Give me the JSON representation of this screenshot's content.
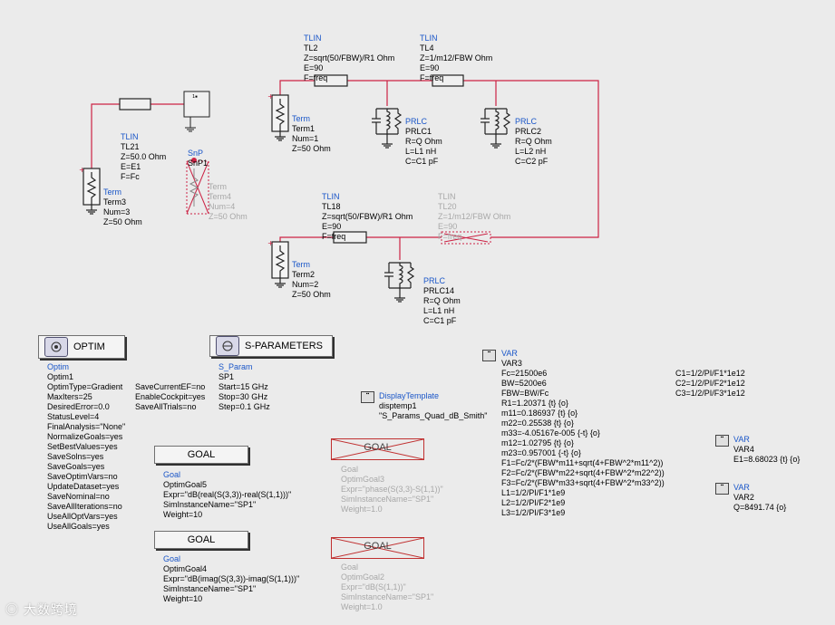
{
  "colors": {
    "wire": "#cc2244",
    "component": "#222222",
    "label_blue": "#1a56c8",
    "disabled": "#a8a8a8",
    "background": "#ebebeb"
  },
  "components": {
    "tl2": {
      "type": "TLIN",
      "name": "TL2",
      "z": "Z=sqrt(50/FBW)/R1 Ohm",
      "e": "E=90",
      "f": "F=freq"
    },
    "tl4": {
      "type": "TLIN",
      "name": "TL4",
      "z": "Z=1/m12/FBW Ohm",
      "e": "E=90",
      "f": "F=freq"
    },
    "tl21": {
      "type": "TLIN",
      "name": "TL21",
      "z": "Z=50.0 Ohm",
      "e": "E=E1",
      "f": "F=Fc"
    },
    "tl18": {
      "type": "TLIN",
      "name": "TL18",
      "z": "Z=sqrt(50/FBW)/R1 Ohm",
      "e": "E=90",
      "f": "F=freq"
    },
    "tl20": {
      "type": "TLIN",
      "name": "TL20",
      "z": "Z=1/m12/FBW Ohm",
      "e": "E=90",
      "f": "F=freq"
    },
    "term1": {
      "type": "Term",
      "name": "Term1",
      "num": "Num=1",
      "z": "Z=50 Ohm"
    },
    "term2": {
      "type": "Term",
      "name": "Term2",
      "num": "Num=2",
      "z": "Z=50 Ohm"
    },
    "term3": {
      "type": "Term",
      "name": "Term3",
      "num": "Num=3",
      "z": "Z=50 Ohm"
    },
    "term4": {
      "type": "Term",
      "name": "Term4",
      "num": "Num=4",
      "z": "Z=50 Ohm"
    },
    "snp": {
      "type": "SnP",
      "name": "SnP1"
    },
    "prlc1": {
      "type": "PRLC",
      "name": "PRLC1",
      "r": "R=Q Ohm",
      "l": "L=L1 nH",
      "c": "C=C1 pF"
    },
    "prlc2": {
      "type": "PRLC",
      "name": "PRLC2",
      "r": "R=Q Ohm",
      "l": "L=L2 nH",
      "c": "C=C2 pF"
    },
    "prlc14": {
      "type": "PRLC",
      "name": "PRLC14",
      "r": "R=Q Ohm",
      "l": "L=L1 nH",
      "c": "C=C1 pF"
    }
  },
  "optim": {
    "title": "OPTIM",
    "lines": [
      "Optim",
      "Optim1",
      "OptimType=Gradient",
      "MaxIters=25",
      "DesiredError=0.0",
      "StatusLevel=4",
      "FinalAnalysis=\"None\"",
      "NormalizeGoals=yes",
      "SetBestValues=yes",
      "SaveSolns=yes",
      "SaveGoals=yes",
      "SaveOptimVars=no",
      "UpdateDataset=yes",
      "SaveNominal=no",
      "SaveAllIterations=no",
      "UseAllOptVars=yes",
      "UseAllGoals=yes"
    ],
    "lines2": [
      "SaveCurrentEF=no",
      "EnableCockpit=yes",
      "SaveAllTrials=no"
    ]
  },
  "sparam": {
    "title": "S-PARAMETERS",
    "lines": [
      "S_Param",
      "SP1",
      "Start=15 GHz",
      "Stop=30 GHz",
      "Step=0.1 GHz"
    ]
  },
  "display": {
    "lines": [
      "DisplayTemplate",
      "disptemp1",
      "\"S_Params_Quad_dB_Smith\""
    ]
  },
  "var3": {
    "lines": [
      "VAR",
      "VAR3",
      "Fc=21500e6",
      "BW=5200e6",
      "FBW=BW/Fc",
      "R1=1.20371 {t} {o}",
      "m11=0.186937 {t} {o}",
      "m22=0.25538 {t} {o}",
      "m33=-4.05167e-005 {-t} {o}",
      "m12=1.02795 {t} {o}",
      "m23=0.957001 {-t} {o}",
      "F1=Fc/2*(FBW*m11+sqrt(4+FBW^2*m11^2))",
      "F2=Fc/2*(FBW*m22+sqrt(4+FBW^2*m22^2))",
      "F3=Fc/2*(FBW*m33+sqrt(4+FBW^2*m33^2))",
      "L1=1/2/PI/F1*1e9",
      "L2=1/2/PI/F2*1e9",
      "L3=1/2/PI/F3*1e9"
    ],
    "col2": [
      "C1=1/2/PI/F1*1e12",
      "C2=1/2/PI/F2*1e12",
      "C3=1/2/PI/F3*1e12"
    ]
  },
  "var4": {
    "lines": [
      "VAR",
      "VAR4",
      "E1=8.68023 {t} {o}"
    ]
  },
  "var2": {
    "lines": [
      "VAR",
      "VAR2",
      "Q=8491.74 {o}"
    ]
  },
  "goal5": {
    "title": "GOAL",
    "lines": [
      "Goal",
      "OptimGoal5",
      "Expr=\"dB(real(S(3,3))-real(S(1,1)))\"",
      "SimInstanceName=\"SP1\"",
      "Weight=10"
    ]
  },
  "goal4": {
    "title": "GOAL",
    "lines": [
      "Goal",
      "OptimGoal4",
      "Expr=\"dB(imag(S(3,3))-imag(S(1,1)))\"",
      "SimInstanceName=\"SP1\"",
      "Weight=10"
    ]
  },
  "goal3": {
    "title": "GOAL",
    "lines": [
      "Goal",
      "OptimGoal3",
      "Expr=\"phase(S(3,3)-S(1,1))\"",
      "SimInstanceName=\"SP1\"",
      "Weight=1.0"
    ]
  },
  "goal2": {
    "title": "GOAL",
    "lines": [
      "Goal",
      "OptimGoal2",
      "Expr=\"dB(S(1,1))\"",
      "SimInstanceName=\"SP1\"",
      "Weight=1.0"
    ]
  },
  "watermark": "大数跨境"
}
